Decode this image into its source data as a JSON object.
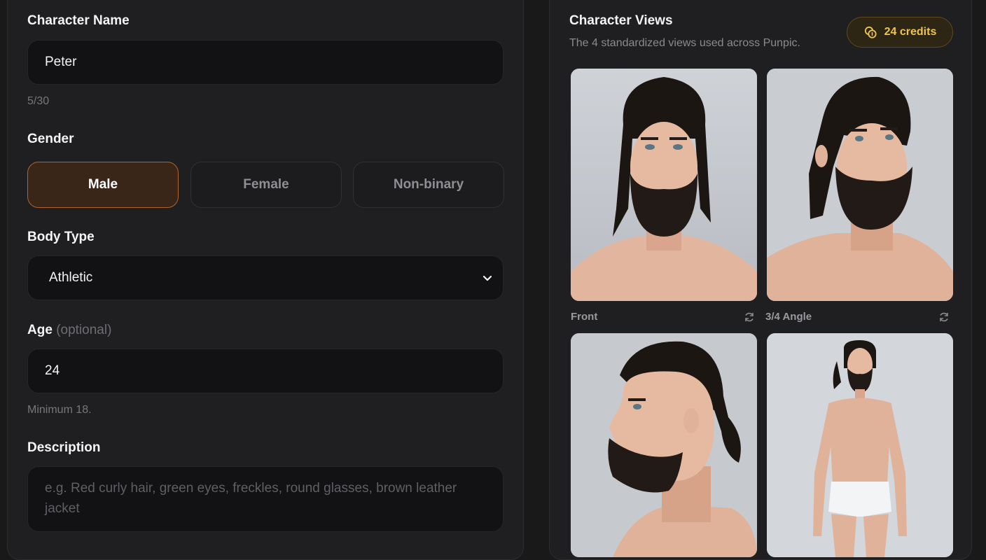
{
  "form": {
    "name_label": "Character Name",
    "name_value": "Peter",
    "name_counter": "5/30",
    "gender_label": "Gender",
    "gender_options": [
      "Male",
      "Female",
      "Non-binary"
    ],
    "gender_selected": "Male",
    "body_label": "Body Type",
    "body_value": "Athletic",
    "age_label": "Age",
    "age_optional": "(optional)",
    "age_value": "24",
    "age_hint": "Minimum 18.",
    "description_label": "Description",
    "description_placeholder": "e.g. Red curly hair, green eyes, freckles, round glasses, brown leather jacket"
  },
  "views": {
    "title": "Character Views",
    "subtitle": "The 4 standardized views used across Punpic.",
    "credits": "24 credits",
    "items": [
      {
        "label": "Front",
        "icon": "refresh-icon"
      },
      {
        "label": "3/4 Angle",
        "icon": "refresh-icon"
      },
      {
        "label": "",
        "icon": ""
      },
      {
        "label": "",
        "icon": ""
      }
    ]
  },
  "colors": {
    "accent": "#b0642c",
    "credits_text": "#f0c44c",
    "background": "#19191a"
  }
}
